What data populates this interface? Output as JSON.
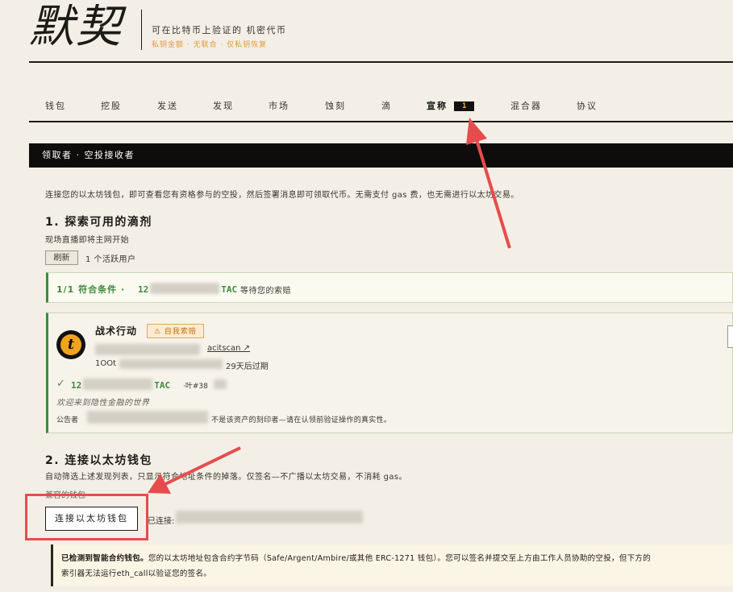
{
  "brand": {
    "logo": "默契",
    "tagline": "可在比特币上验证的 机密代币",
    "subtagline": "私钥金额 · 无联合 · 仅私钥恢复"
  },
  "nav": {
    "items": [
      {
        "label": "钱包"
      },
      {
        "label": "挖股"
      },
      {
        "label": "发送"
      },
      {
        "label": "发现"
      },
      {
        "label": "市场"
      },
      {
        "label": "蚀刻"
      },
      {
        "label": "滴"
      },
      {
        "label": "宣称",
        "badge": "1",
        "active": true
      },
      {
        "label": "混合器"
      },
      {
        "label": "协议"
      }
    ]
  },
  "section": {
    "title": "领取者 · 空投接收者",
    "intro": "连接您的以太坊钱包，即可查看您有资格参与的空投，然后签署消息即可领取代币。无需支付 gas 费，也无需进行以太坊交易。"
  },
  "step1": {
    "title": "1. 探索可用的滴剂",
    "subtitle": "现场直播即将主网开始",
    "refresh_label": "刷新",
    "active_users": "1 个活跃用户",
    "match_label": "1/1 符合条件 ·",
    "match_amount": "12",
    "match_suffix": "TAC",
    "match_waiting": "等待您的索赔"
  },
  "airdrop_card": {
    "avatar_letter": "t",
    "name": "战术行动",
    "self_badge": "⚠ 自我索赔",
    "link_label": "acitscan ↗",
    "expiry_prefix": "1OOt",
    "expiry": "29天后过期",
    "claim_check": "✓",
    "claim_amount": "12",
    "claim_suffix": "TAC",
    "leaf": "·叶#38",
    "welcome": "欢迎来到隐性金融的世界",
    "announcer_label": "公告者",
    "announcer_note": "不是该资产的刻印者—请在认领前验证操作的真实性。"
  },
  "step2": {
    "title": "2. 连接以太坊钱包",
    "subtitle": "自动筛选上述发现列表，只显示符合地址条件的掉落。仅签名—不广播以太坊交易，不消耗 gas。",
    "compatible_label": "兼容的钱包",
    "connect_label": "连接以太坊钱包",
    "connected_label": "已连接:"
  },
  "warning": {
    "bold": "已检测到智能合约钱包。",
    "line1": "您的以太坊地址包含合约字节码（Safe/Argent/Ambire/或其他 ERC-1271 钱包）。您可以签名并提交至上方由工作人员协助的空投，但下方的",
    "line2": "索引器无法运行eth_call以验证您的签名。"
  },
  "colors": {
    "background": "#f3efe6",
    "accent_green": "#3f8a3a",
    "badge_orange": "#c76c10",
    "annotation_red": "#e74c4c"
  }
}
